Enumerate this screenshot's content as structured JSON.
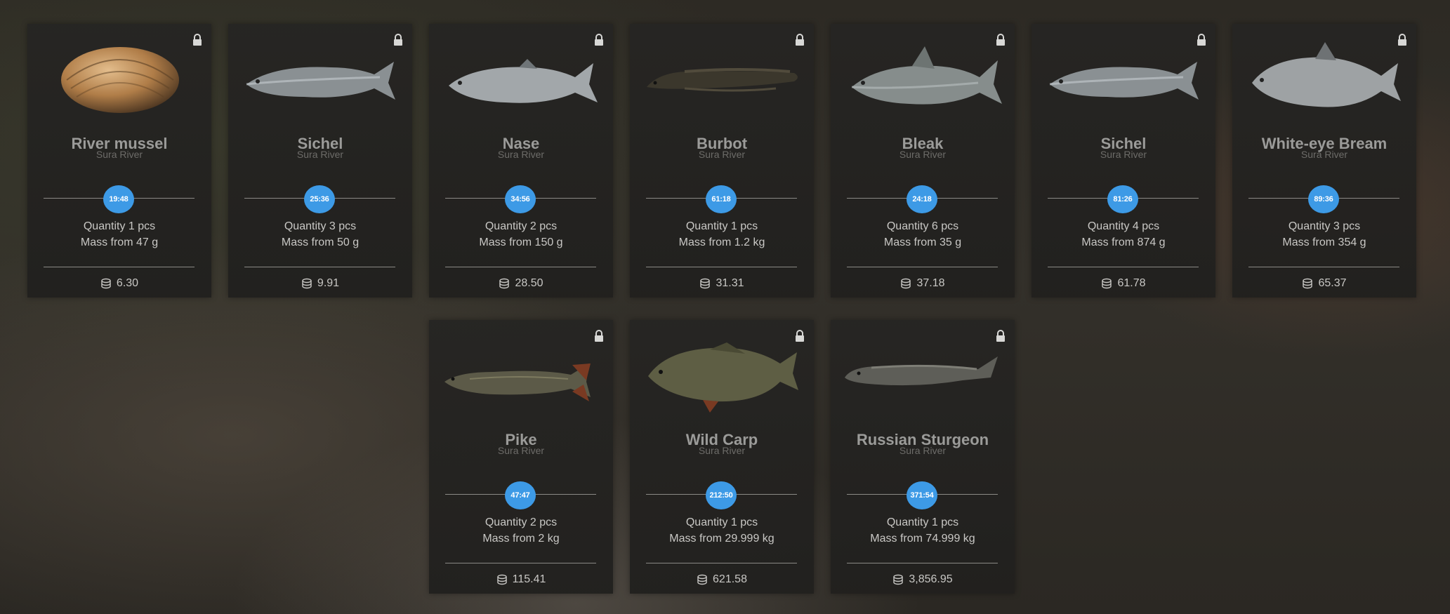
{
  "colors": {
    "accent": "#3d9ae6",
    "card_bg": "#252422",
    "name_text": "#9b9b99",
    "location_text": "#6d6c69",
    "body_text": "#c9c8c5"
  },
  "icons": {
    "lock": "lock-icon",
    "coins": "coins-icon"
  },
  "cards": [
    {
      "name": "River mussel",
      "location": "Sura River",
      "time": "19:48",
      "quantity": "Quantity 1 pcs",
      "mass": "Mass from 47 g",
      "price": "6.30",
      "image": "river-mussel"
    },
    {
      "name": "Sichel",
      "location": "Sura River",
      "time": "25:36",
      "quantity": "Quantity 3 pcs",
      "mass": "Mass from 50 g",
      "price": "9.91",
      "image": "sichel"
    },
    {
      "name": "Nase",
      "location": "Sura River",
      "time": "34:56",
      "quantity": "Quantity 2 pcs",
      "mass": "Mass from 150 g",
      "price": "28.50",
      "image": "nase"
    },
    {
      "name": "Burbot",
      "location": "Sura River",
      "time": "61:18",
      "quantity": "Quantity 1 pcs",
      "mass": "Mass from 1.2 kg",
      "price": "31.31",
      "image": "burbot"
    },
    {
      "name": "Bleak",
      "location": "Sura River",
      "time": "24:18",
      "quantity": "Quantity 6 pcs",
      "mass": "Mass from 35 g",
      "price": "37.18",
      "image": "bleak"
    },
    {
      "name": "Sichel",
      "location": "Sura River",
      "time": "81:26",
      "quantity": "Quantity 4 pcs",
      "mass": "Mass from 874 g",
      "price": "61.78",
      "image": "sichel"
    },
    {
      "name": "White-eye Bream",
      "location": "Sura River",
      "time": "89:36",
      "quantity": "Quantity 3 pcs",
      "mass": "Mass from 354 g",
      "price": "65.37",
      "image": "white-eye-bream"
    },
    {
      "name": "Pike",
      "location": "Sura River",
      "time": "47:47",
      "quantity": "Quantity 2 pcs",
      "mass": "Mass from 2 kg",
      "price": "115.41",
      "image": "pike"
    },
    {
      "name": "Wild Carp",
      "location": "Sura River",
      "time": "212:50",
      "quantity": "Quantity 1 pcs",
      "mass": "Mass from 29.999 kg",
      "price": "621.58",
      "image": "wild-carp"
    },
    {
      "name": "Russian Sturgeon",
      "location": "Sura River",
      "time": "371:54",
      "quantity": "Quantity 1 pcs",
      "mass": "Mass from 74.999 kg",
      "price": "3,856.95",
      "image": "russian-sturgeon"
    }
  ]
}
